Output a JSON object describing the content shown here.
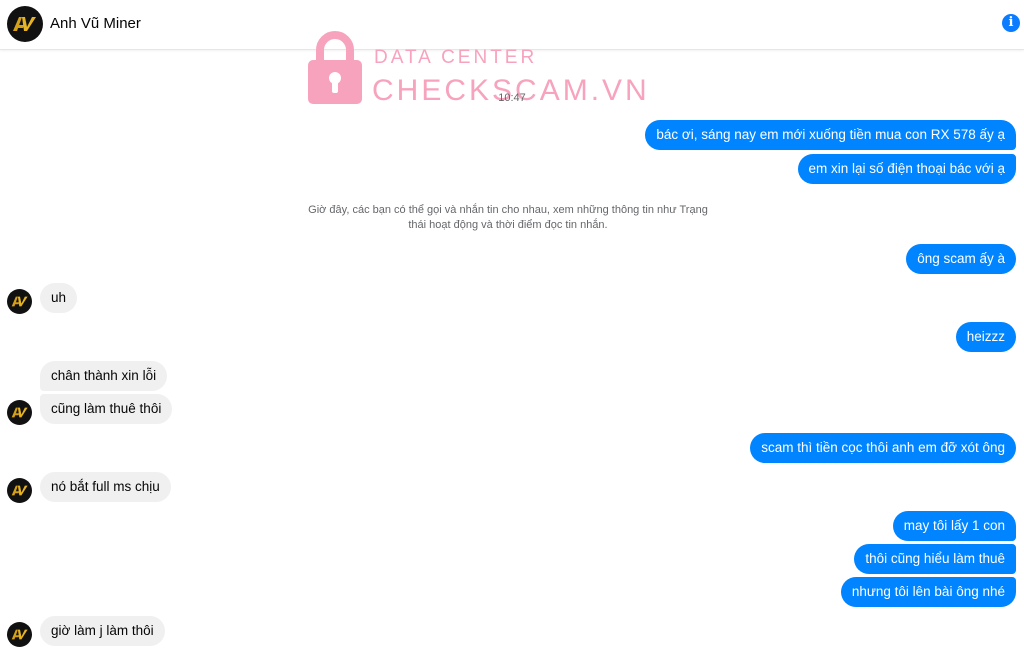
{
  "header": {
    "contact_name": "Anh Vũ Miner",
    "info_icon_glyph": "i",
    "info_icon": "info-circle-icon"
  },
  "watermark": {
    "top_text": "DATA CENTER",
    "main_text": "CHECKSCAM.VN",
    "icon": "lock-icon",
    "color": "#f7a3bd"
  },
  "conversation": {
    "timestamp": "10:47",
    "system_notice": "Giờ đây, các bạn có thể gọi và nhắn tin cho nhau, xem những thông tin như Trạng thái hoạt động và thời điểm đọc tin nhắn.",
    "messages": [
      {
        "from": "me",
        "text": "bác ơi, sáng nay em mới xuống tiền mua con RX 578 ấy ạ"
      },
      {
        "from": "me",
        "text": "em xin lại số điện thoại bác với ạ"
      },
      {
        "from": "me",
        "text": "ông scam ấy à"
      },
      {
        "from": "contact",
        "text": "uh"
      },
      {
        "from": "me",
        "text": "heizzz"
      },
      {
        "from": "contact",
        "text": "chân thành xin lỗi"
      },
      {
        "from": "contact",
        "text": "cũng làm thuê thôi"
      },
      {
        "from": "me",
        "text": "scam thì tiền cọc thôi anh em đỡ xót ông"
      },
      {
        "from": "contact",
        "text": "nó bắt full ms chịu"
      },
      {
        "from": "me",
        "text": "may tôi lấy 1 con"
      },
      {
        "from": "me",
        "text": "thôi cũng hiểu làm thuê"
      },
      {
        "from": "me",
        "text": "nhưng tôi lên bài ông nhé"
      },
      {
        "from": "contact",
        "text": "giờ làm j làm thôi"
      }
    ]
  },
  "colors": {
    "outgoing_bubble": "#0084ff",
    "incoming_bubble": "#f0f0f0",
    "accent": "#0a7cff"
  }
}
